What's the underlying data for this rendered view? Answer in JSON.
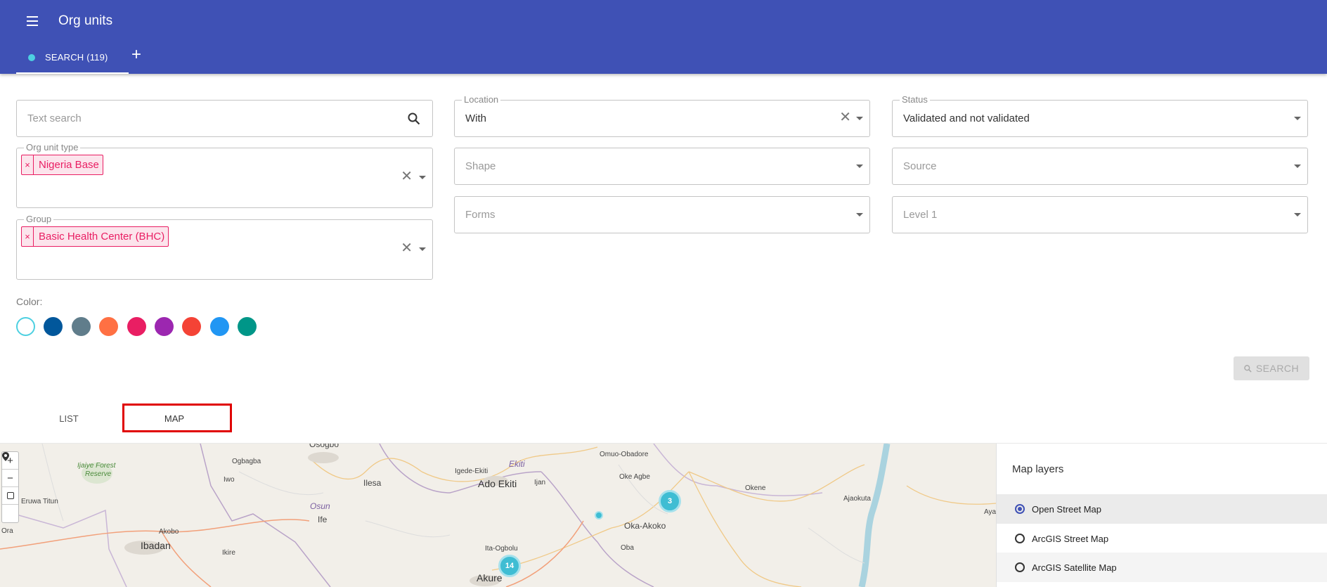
{
  "header": {
    "title": "Org units",
    "tab_label": "SEARCH (119)",
    "add_tab": "+",
    "bg_color": "#3f51b5"
  },
  "filters": {
    "text_search": {
      "placeholder": "Text search"
    },
    "org_unit_type": {
      "label": "Org unit type",
      "chips": [
        "Nigeria Base"
      ]
    },
    "group": {
      "label": "Group",
      "chips": [
        "Basic Health Center (BHC)"
      ]
    },
    "location": {
      "label": "Location",
      "value": "With"
    },
    "shape": {
      "placeholder": "Shape"
    },
    "forms": {
      "placeholder": "Forms"
    },
    "status": {
      "label": "Status",
      "value": "Validated and not validated"
    },
    "source": {
      "placeholder": "Source"
    },
    "level1": {
      "placeholder": "Level 1"
    }
  },
  "color": {
    "label": "Color:",
    "swatches": [
      "#ffffff",
      "#01579b",
      "#607d8b",
      "#ff7043",
      "#e91e63",
      "#9c27b0",
      "#f44336",
      "#2196f3",
      "#009688"
    ],
    "selected_ring": "#4dd0e1"
  },
  "search_button": {
    "label": "SEARCH",
    "icon": "search-icon"
  },
  "view_tabs": {
    "list": "LIST",
    "map": "MAP"
  },
  "map": {
    "zoom_in": "+",
    "zoom_out": "−",
    "labels": {
      "osogbo": "Osogbo",
      "ijaiye": "Ijaiye Forest",
      "reserve": "Reserve",
      "ogbagba": "Ogbagba",
      "iwo": "Iwo",
      "igede": "Igede-Ekiti",
      "ekiti": "Ekiti",
      "omuo": "Omuo-Obadore",
      "ilesa": "Ilesa",
      "ado": "Ado Ekiti",
      "ijan": "Ijan",
      "oke_agbe": "Oke Agbe",
      "okene": "Okene",
      "ajaokuta": "Ajaokuta",
      "eruwa": "Eruwa Titun",
      "osun": "Osun",
      "ife": "Ife",
      "oka_akoko": "Oka-Akoko",
      "aya": "Aya",
      "ora": "Ora",
      "akobo": "Akobo",
      "ibadan": "Ibadan",
      "ikire": "Ikire",
      "ita_ogbolu": "Ita-Ogbolu",
      "oba": "Oba",
      "akure": "Akure"
    },
    "clusters": [
      {
        "count": "3"
      },
      {
        "count": "14"
      }
    ]
  },
  "layers": {
    "title": "Map layers",
    "items": [
      {
        "label": "Open Street Map",
        "selected": true
      },
      {
        "label": "ArcGIS Street Map",
        "selected": false
      },
      {
        "label": "ArcGIS Satellite Map",
        "selected": false
      }
    ]
  }
}
